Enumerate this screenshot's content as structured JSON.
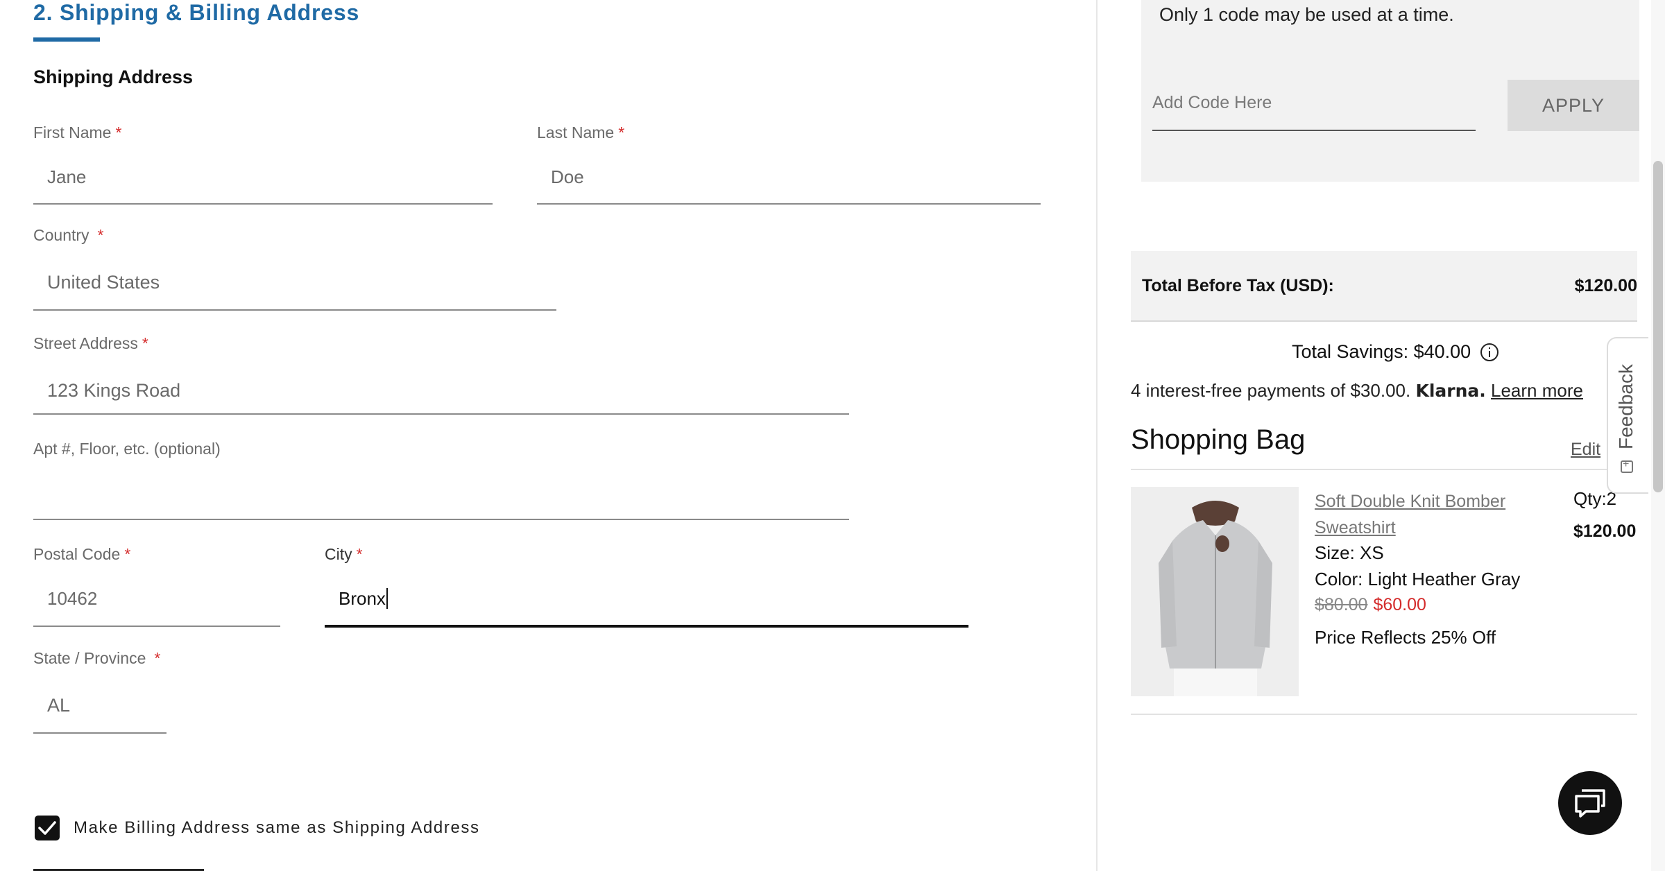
{
  "form": {
    "section_title": "2. Shipping & Billing Address",
    "shipping_heading": "Shipping Address",
    "required_mark": "*",
    "fields": {
      "first_name": {
        "label": "First Name",
        "value": "Jane"
      },
      "last_name": {
        "label": "Last Name",
        "value": "Doe"
      },
      "country": {
        "label": "Country",
        "value": "United States"
      },
      "street": {
        "label": "Street Address",
        "value": "123 Kings Road"
      },
      "apt": {
        "label": "Apt #, Floor, etc. (optional)",
        "value": ""
      },
      "postal": {
        "label": "Postal Code",
        "value": "10462"
      },
      "city": {
        "label": "City",
        "value": "Bronx"
      },
      "state": {
        "label": "State / Province",
        "value": "AL"
      }
    },
    "billing_same": {
      "label": "Make Billing Address same as Shipping Address",
      "checked": true
    }
  },
  "summary": {
    "promo": {
      "note": "Only 1 code may be used at a time.",
      "placeholder": "Add Code Here",
      "apply_label": "APPLY"
    },
    "total_before_tax": {
      "label": "Total Before Tax (USD):",
      "value": "$120.00"
    },
    "total_savings": "Total Savings: $40.00",
    "klarna": {
      "text": "4 interest-free payments of $30.00.",
      "brand": "Klarna.",
      "link": "Learn more"
    },
    "bag": {
      "title": "Shopping Bag",
      "edit_label": "Edit",
      "item": {
        "name": "Soft Double Knit Bomber Sweatshirt",
        "size": "Size: XS",
        "color": "Color: Light Heather Gray",
        "price_original": "$80.00",
        "price_sale": "$60.00",
        "promo_note": "Price Reflects 25% Off",
        "qty": "Qty:2",
        "line_total": "$120.00"
      }
    }
  },
  "feedback_label": "Feedback",
  "colors": {
    "accent": "#1f6aa5",
    "required": "#d42b2b",
    "sale": "#d42b2b"
  },
  "icons": [
    "checkbox-checked-icon",
    "info-icon",
    "feedback-icon",
    "chat-icon"
  ]
}
